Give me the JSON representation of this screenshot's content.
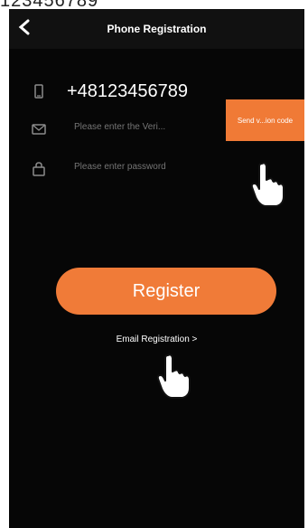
{
  "top_crop_text": "123456789",
  "header": {
    "title": "Phone Registration"
  },
  "form": {
    "phone": {
      "value": "+48123456789"
    },
    "code": {
      "placeholder": "Please enter the Veri...",
      "send_label": "Send v...ion code"
    },
    "password": {
      "placeholder": "Please enter password"
    }
  },
  "actions": {
    "register_label": "Register",
    "email_link": "Email Registration >"
  },
  "colors": {
    "accent": "#f07a36",
    "background": "#060606"
  }
}
